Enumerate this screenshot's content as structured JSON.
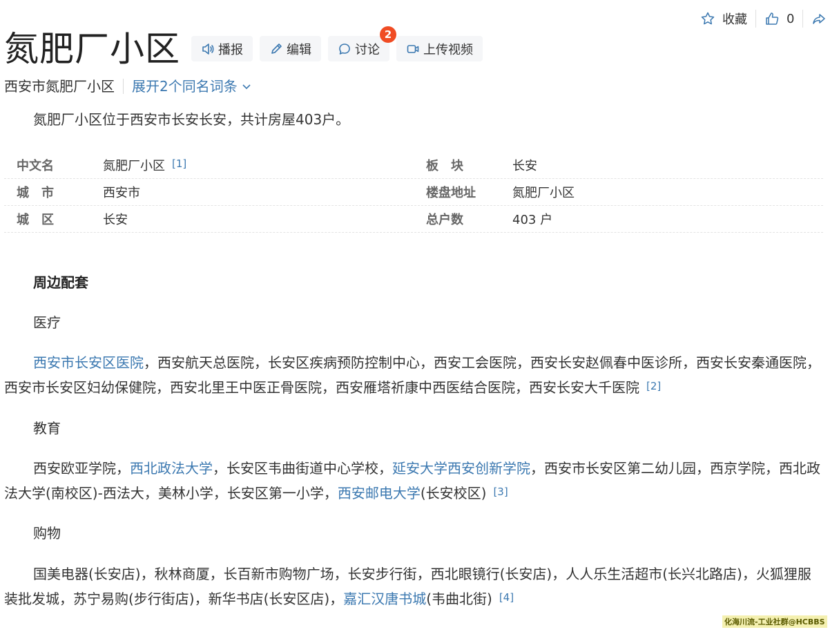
{
  "title": "氮肥厂小区",
  "toolbar": {
    "broadcast": "播报",
    "edit": "编辑",
    "discuss": "讨论",
    "discuss_count": "2",
    "upload_video": "上传视频"
  },
  "actions": {
    "favorite": "收藏",
    "like_count": "0"
  },
  "subtitle": {
    "name": "西安市氮肥厂小区",
    "expand": "展开2个同名词条"
  },
  "summary": "氮肥厂小区位于西安市长安长安，共计房屋403户。",
  "info_rows": [
    {
      "l1": "中文名",
      "v1": "氮肥厂小区",
      "ref1": "[1]",
      "l2": "板　块",
      "v2": "长安"
    },
    {
      "l1": "城　市",
      "v1": "西安市",
      "ref1": "",
      "l2": "楼盘地址",
      "v2": "氮肥厂小区"
    },
    {
      "l1": "城　区",
      "v1": "长安",
      "ref1": "",
      "l2": "总户数",
      "v2": "403 户"
    }
  ],
  "section_title": "周边配套",
  "medical": {
    "title": "医疗",
    "link1": "西安市长安区医院",
    "text": "，西安航天总医院，长安区疾病预防控制中心，西安工会医院，西安长安赵佩春中医诊所，西安长安秦通医院，西安市长安区妇幼保健院，西安北里王中医正骨医院，西安雁塔祈康中西医结合医院，西安长安大千医院",
    "ref": "[2]"
  },
  "education": {
    "title": "教育",
    "t1": "西安欧亚学院，",
    "link1": "西北政法大学",
    "t2": "，长安区韦曲街道中心学校，",
    "link2": "延安大学西安创新学院",
    "t3": "，西安市长安区第二幼儿园，西京学院，西北政法大学(南校区)-西法大，美林小学，长安区第一小学，",
    "link3": "西安邮电大学",
    "t4": "(长安校区)",
    "ref": "[3]"
  },
  "shopping": {
    "title": "购物",
    "t1": "国美电器(长安店)，秋林商厦，长百新市购物广场，长安步行街，西北眼镜行(长安店)，人人乐生活超市(长兴北路店)，火狐狸服装批发城，苏宁易购(步行街店)，新华书店(长安区店)，",
    "link1": "嘉汇汉唐书城",
    "t2": "(韦曲北街)",
    "ref": "[4]"
  },
  "watermark": "化海川流-工业社群@HCBBS",
  "colors": {
    "link": "#3b78b0",
    "badge": "#f04c24",
    "toolbar_bg": "#f5f6f8"
  }
}
